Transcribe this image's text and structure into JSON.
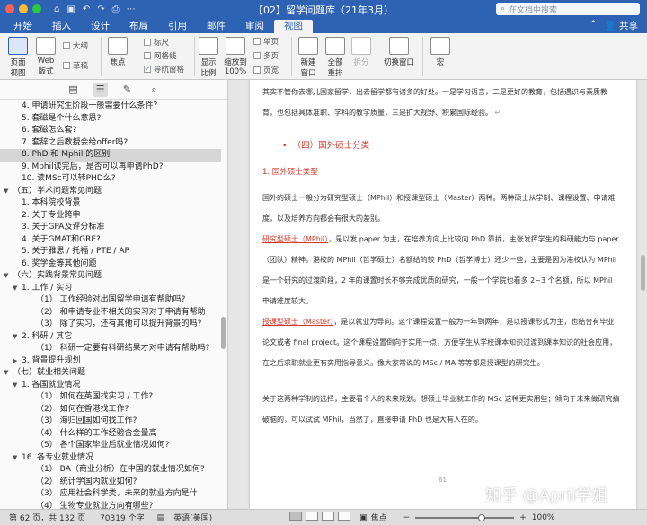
{
  "titlebar": {
    "title": "【02】留学问题库（21年3月）",
    "search_placeholder": "在文档中搜索",
    "traffic_colors": [
      "#ff5f57",
      "#febc2e",
      "#28c840"
    ]
  },
  "tabs": [
    "开始",
    "插入",
    "设计",
    "布局",
    "引用",
    "邮件",
    "审阅",
    "视图"
  ],
  "active_tab": "视图",
  "share_label": "共享",
  "ribbon": {
    "page_view": "页面\n视图",
    "web_view": "Web\n版式",
    "outline": "大纲",
    "draft": "草稿",
    "focus": "焦点",
    "ruler": "标尺",
    "gridlines": "网格线",
    "nav_pane": "导航窗格",
    "zoom": "显示\n比例",
    "zoom_100": "缩放到\n100%",
    "single_page": "单页",
    "multi_page": "多页",
    "page_width": "页宽",
    "new_window": "新建\n窗口",
    "arrange_all": "全部\n重排",
    "split": "拆分",
    "switch_window": "切换窗口",
    "macros": "宏"
  },
  "sidebar": {
    "tool_icons": [
      "thumbnails-icon",
      "outline-list-icon",
      "comments-icon",
      "search-icon"
    ],
    "items": [
      {
        "label": "4. 申请研究生阶段一般需要什么条件？",
        "indent": 2,
        "arrow": ""
      },
      {
        "label": "5. 套磁是个什么意思?",
        "indent": 2,
        "arrow": ""
      },
      {
        "label": "6. 套磁怎么套?",
        "indent": 2,
        "arrow": ""
      },
      {
        "label": "7. 套辞之后教授会给offer吗?",
        "indent": 2,
        "arrow": ""
      },
      {
        "label": "8. PhD 和 Mphil 的区别",
        "indent": 2,
        "arrow": "",
        "selected": true
      },
      {
        "label": "9. Mphil读完后，是否可以再申请PhD?",
        "indent": 2,
        "arrow": ""
      },
      {
        "label": "10. 读MSc可以转PHD么?",
        "indent": 2,
        "arrow": ""
      },
      {
        "label": "（五）学术问题常见问题",
        "indent": 1,
        "arrow": "▼"
      },
      {
        "label": "1. 本科院校背景",
        "indent": 2,
        "arrow": ""
      },
      {
        "label": "2. 关于专业跨申",
        "indent": 2,
        "arrow": ""
      },
      {
        "label": "3. 关于GPA及评分标准",
        "indent": 2,
        "arrow": ""
      },
      {
        "label": "4. 关于GMAT和GRE?",
        "indent": 2,
        "arrow": ""
      },
      {
        "label": "5. 关于雅思 / 托福 / PTE / AP",
        "indent": 2,
        "arrow": ""
      },
      {
        "label": "6. 奖学金等其他问题",
        "indent": 2,
        "arrow": ""
      },
      {
        "label": "（六）实践背景常见问题",
        "indent": 1,
        "arrow": "▼"
      },
      {
        "label": "1. 工作 / 实习",
        "indent": 2,
        "arrow": "▼"
      },
      {
        "label": "（1）  工作经验对出国留学申请有帮助吗?",
        "indent": 3,
        "arrow": ""
      },
      {
        "label": "（2）  和申请专业不相关的实习对于申请有帮助",
        "indent": 3,
        "arrow": ""
      },
      {
        "label": "（3）  除了实习，还有其他可以提升背景的吗?",
        "indent": 3,
        "arrow": ""
      },
      {
        "label": "2. 科研 / 其它",
        "indent": 2,
        "arrow": "▼"
      },
      {
        "label": "（1）  科研一定要有科研结果才对申请有帮助吗?",
        "indent": 3,
        "arrow": ""
      },
      {
        "label": "3. 背景提升规划",
        "indent": 2,
        "arrow": "▶"
      },
      {
        "label": "（七）就业相关问题",
        "indent": 1,
        "arrow": "▼"
      },
      {
        "label": "1. 各国就业情况",
        "indent": 2,
        "arrow": "▼"
      },
      {
        "label": "（1）  如何在英国找实习 / 工作?",
        "indent": 3,
        "arrow": ""
      },
      {
        "label": "（2）  如何在香港找工作?",
        "indent": 3,
        "arrow": ""
      },
      {
        "label": "（3）  海归回国如何找工作?",
        "indent": 3,
        "arrow": ""
      },
      {
        "label": "（4）  什么样的工作经验含金量高",
        "indent": 3,
        "arrow": ""
      },
      {
        "label": "（5）  各个国家毕业后就业情况如何?",
        "indent": 3,
        "arrow": ""
      },
      {
        "label": "16. 各专业就业情况",
        "indent": 2,
        "arrow": "▼"
      },
      {
        "label": "（1）  BA（商业分析）在中国的就业情况如何?",
        "indent": 3,
        "arrow": ""
      },
      {
        "label": "（2）  统计学国内就业如何?",
        "indent": 3,
        "arrow": ""
      },
      {
        "label": "（3）  应用社会科学类，未来的就业方向是什",
        "indent": 3,
        "arrow": ""
      },
      {
        "label": "（4）  生物专业就业方向有哪些?",
        "indent": 3,
        "arrow": ""
      }
    ]
  },
  "document": {
    "p0": "其实不管你去哪儿国家留学，出去留学都有诸多的好处。一是学习语言，二是更好的教育，包括遇识与素质教育，也包括具体准职、学科的教学质量，三是扩大视野、积累国际经验。",
    "section_title": "（四）国外硕士分类",
    "sub_title": "1.  国外硕士类型",
    "p1": "国外的硕士一般分为研究型硕士（MPhil）和授课型硕士（Master）两种。两种硕士从学制、课程设置、申请难度，以及培养方向都会有很大的差别。",
    "p2_lead": "研究型硕士（MPhil）",
    "p2": "，是以发 paper 为主，在培养方向上比较向 PhD 靠拢，主张发挥学生的科研能力与 paper（团队）精神。港校的 MPhil（哲学硕士）名额给的较 PhD（哲学博士）还少一些，主要是因为港校认为 MPhil 是一个研究的过渡阶段，2 年的课置时长不够完成优质的研究，一般一个学院也看多 2~3 个名额，所以 MPhil 申请难度较大。",
    "p3_lead": "授课型硕士（Master）",
    "p3": "，是以就业为导向。这个课程设置一般为一年到两年，是以授课形式为主，也结合有毕业论文或者 final project。这个课程设置倒向于实用一点，方便学生从学校课本知识过渡到课本知识的社会应用，在之后求职就业更有实用指导意义。像大家常说的 MSc / MA 等等都是授课型的研究生。",
    "p4": "关于这两种学制的选择，主要看个人的未来规划。想硕士毕业就工作的 MSc 这种更实用些；倾向于未来做研究搞破脑的，可以试试 MPhil，当然了，直接申请 PhD 也是大有人在的。",
    "page_num": "61"
  },
  "watermark": "知乎 @April学姐",
  "statusbar": {
    "page": "第 62 页，共 132 页",
    "words": "70319 个字",
    "lang": "英语(美国)",
    "focus": "焦点",
    "zoom": "100%"
  }
}
